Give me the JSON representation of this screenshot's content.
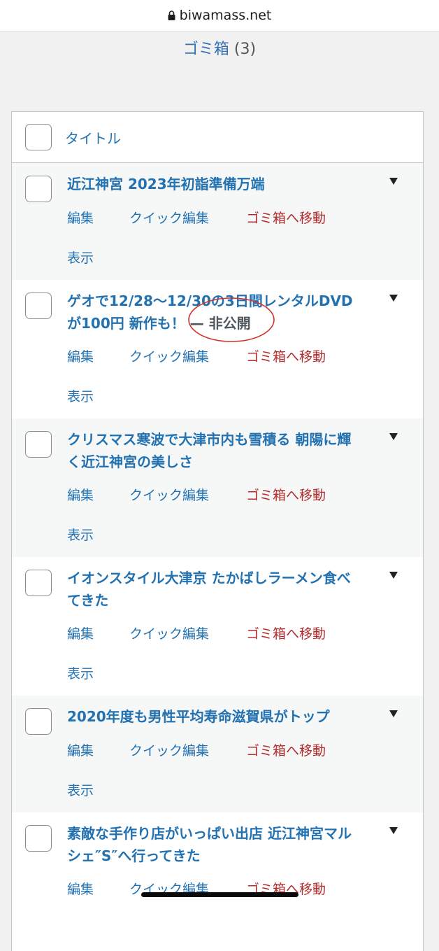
{
  "browser": {
    "domain": "biwamass.net",
    "lock_icon": "lock-icon"
  },
  "page": {
    "trash_label": "ゴミ箱",
    "trash_count": "(3)"
  },
  "table": {
    "header": {
      "title": "タイトル"
    },
    "actions": {
      "edit": "編集",
      "quick_edit": "クイック編集",
      "trash": "ゴミ箱へ移動",
      "view": "表示"
    },
    "rows": [
      {
        "title_l1": "近江神宮 2023年初詣準備万端",
        "title_l2": ""
      },
      {
        "title_l1": "ゲオで12/28〜12/30の3日間レンタルDVD",
        "title_l2": "が100円 新作も！",
        "state": "— 非公開"
      },
      {
        "title_l1": "クリスマス寒波で大津市内も雪積る 朝陽に輝",
        "title_l2": "く近江神宮の美しさ"
      },
      {
        "title_l1": "イオンスタイル大津京 たかばしラーメン食べ",
        "title_l2": "てきた"
      },
      {
        "title_l1": "2020年度も男性平均寿命滋賀県がトップ",
        "title_l2": ""
      },
      {
        "title_l1": "素敵な手作り店がいっぱい出店 近江神宮マル",
        "title_l2": "シェ″S″へ行ってきた"
      }
    ]
  },
  "colors": {
    "link": "#2271b1",
    "delete": "#b32d2e",
    "annotation": "#d0312d"
  }
}
